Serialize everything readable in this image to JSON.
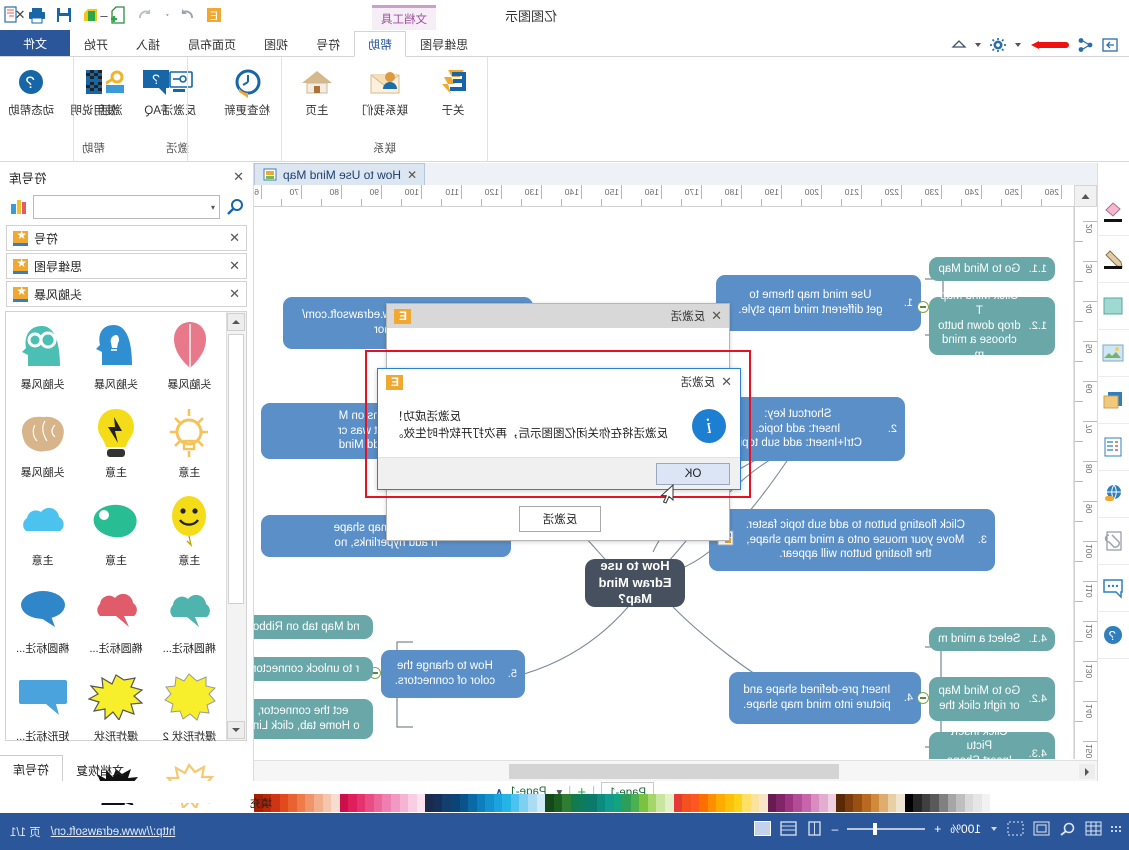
{
  "window": {
    "title": "亿图图示",
    "controls": {
      "close": "✕",
      "maximize": "□",
      "minimize": "–"
    }
  },
  "quick_access": {
    "icons": [
      "customize-icon",
      "dropdown-caret-icon",
      "print-preview-icon",
      "print-icon",
      "save-icon",
      "new-color-icon",
      "new-doc-icon",
      "undo-icon",
      "undo-caret-icon",
      "redo-icon",
      "edraw-logo-icon"
    ]
  },
  "ribbon": {
    "context_tab": "文档工具",
    "tabs": [
      {
        "label": "文件",
        "state": "file"
      },
      {
        "label": "开始",
        "state": "normal"
      },
      {
        "label": "插入",
        "state": "normal"
      },
      {
        "label": "页面布局",
        "state": "normal"
      },
      {
        "label": "视图",
        "state": "normal"
      },
      {
        "label": "符号",
        "state": "normal"
      },
      {
        "label": "帮助",
        "state": "active"
      },
      {
        "label": "思维导图",
        "state": "normal"
      }
    ],
    "groups": [
      {
        "name": "联系",
        "items": [
          {
            "label": "关于",
            "icon": "edraw-about-icon"
          },
          {
            "label": "联系我们",
            "icon": "mail-contact-icon"
          },
          {
            "label": "主页",
            "icon": "home-icon"
          }
        ]
      },
      {
        "name": "激活",
        "items": [
          {
            "label": "检查更新",
            "icon": "check-update-icon"
          },
          {
            "label": "反激活",
            "icon": "deactivate-icon"
          },
          {
            "label": "激活",
            "icon": "activate-key-icon"
          }
        ]
      },
      {
        "name": "帮助",
        "items": [
          {
            "label": "FAQ",
            "icon": "faq-icon"
          },
          {
            "label": "使用说明",
            "icon": "manual-icon"
          },
          {
            "label": "动态帮助",
            "icon": "dynamic-help-icon"
          }
        ]
      }
    ]
  },
  "secondary_toolbar": {
    "icons": [
      "home-small-icon",
      "caret-down-icon",
      "gear-icon",
      "caret-down-icon",
      "red-marker-icon",
      "share-icon",
      "export-icon"
    ]
  },
  "left_tools": [
    {
      "icon": "fill-bucket-icon"
    },
    {
      "icon": "pencil-line-icon"
    },
    {
      "icon": "shape-square-icon"
    },
    {
      "icon": "picture-icon"
    },
    {
      "icon": "layers-icon"
    },
    {
      "icon": "list-data-icon"
    },
    {
      "icon": "hyperlink-globe-icon"
    },
    {
      "icon": "attachment-doc-icon"
    },
    {
      "icon": "comment-icon"
    },
    {
      "icon": "help-circle-icon"
    }
  ],
  "document_tab": {
    "label": "How to Use Mind Map",
    "close": "✕",
    "icon": "document-icon"
  },
  "rulers": {
    "horizontal_ticks": [
      "260",
      "250",
      "240",
      "230",
      "220",
      "210",
      "200",
      "190",
      "180",
      "170",
      "160",
      "150",
      "140",
      "130",
      "120",
      "110",
      "100",
      "90",
      "80",
      "70",
      "60"
    ],
    "vertical_ticks": [
      "20",
      "30",
      "40",
      "50",
      "60",
      "70",
      "80",
      "90",
      "100",
      "110",
      "120",
      "130",
      "140",
      "150"
    ]
  },
  "mindmap": {
    "center": "How to use\nEdraw Mind Map?",
    "nodes": [
      {
        "id": "n1",
        "num": "1.",
        "text": "Use mind map theme to\nget different mind map style."
      },
      {
        "id": "n1_1",
        "num": "1.1.",
        "text": "Go to Mind Map"
      },
      {
        "id": "n1_2",
        "num": "1.2.",
        "text": "Click Mind Map T\ndrop down butto\nchoose a mind m"
      },
      {
        "id": "n2",
        "num": "2.",
        "text": "Shortcut key:\nInsert: add topic.\nCtrl+Insert: add sub topic"
      },
      {
        "id": "n3",
        "num": "3.",
        "text": "Click floating button to add sub topic faster.\nMove your mouse onto a mind map shape,\nthe floating button will appear."
      },
      {
        "id": "n4",
        "num": "4.",
        "text": "Insert pre-defined shape and\npicture into mind map shape."
      },
      {
        "id": "n4_1",
        "num": "4.1.",
        "text": "Select a mind m"
      },
      {
        "id": "n4_2",
        "num": "4.2.",
        "text": "Go to Mind Map\nor right click the"
      },
      {
        "id": "n4_3",
        "num": "4.3.",
        "text": "Click Insert Pictu\nInsert Shape Fro"
      },
      {
        "id": "n5",
        "num": "5.",
        "text": "How to change the\ncolor of connectors."
      },
      {
        "id": "n5_1",
        "num": "",
        "text": "nd Map tab on Ribbon"
      },
      {
        "id": "n5_2",
        "num": "",
        "text": "r to unlock connectors"
      },
      {
        "id": "n5_3",
        "num": "",
        "text": "ect the connector,\no Home tab, click Line"
      },
      {
        "id": "n6",
        "num": "",
        "text": "lick mind map shape\nn add hyperlinks, no"
      },
      {
        "id": "n7",
        "num": "",
        "text": "ore functions on M\na document was cr\ndraw will add Mind"
      },
      {
        "id": "n8",
        "num": "8.",
        "text": "Please visit http://www.edrawsoft.com/\nto get mor"
      }
    ]
  },
  "dialog_back": {
    "title": "反激活",
    "close": "✕"
  },
  "dialog_front": {
    "title": "反激活",
    "close": "✕",
    "line1": "反激活成功！",
    "line2": "反激活将在你关闭亿图图示后，再次打开软件时生效。",
    "ok_label": "OK",
    "icon": "info-icon"
  },
  "middle_button": {
    "label": "反激活"
  },
  "right_panel": {
    "title": "符号库",
    "close": "✕",
    "search_placeholder": "",
    "search_icon": "search-icon",
    "libraries": [
      {
        "name": "符号",
        "close": "✕"
      },
      {
        "name": "思维导图",
        "close": "✕"
      },
      {
        "name": "头脑风暴",
        "close": "✕"
      }
    ],
    "symbols": [
      {
        "label": "头脑风暴",
        "art": "brain-pink-icon",
        "color": "#e8798b"
      },
      {
        "label": "头脑风暴",
        "art": "head-bulb-icon",
        "color": "#2f8fd0"
      },
      {
        "label": "头脑风暴",
        "art": "head-gears-icon",
        "color": "#4bbfb3"
      },
      {
        "label": "主意",
        "art": "bulb-rays-icon",
        "color": "#f4c35a"
      },
      {
        "label": "主意",
        "art": "bulb-yellow-icon",
        "color": "#f5dc19"
      },
      {
        "label": "头脑风暴",
        "art": "brain-tan-icon",
        "color": "#d7b48a"
      },
      {
        "label": "主意",
        "art": "balloon-smiley-icon",
        "color": "#f5dc19"
      },
      {
        "label": "主意",
        "art": "blob-green-icon",
        "color": "#28bd93"
      },
      {
        "label": "主意",
        "art": "cloud-blue-icon",
        "color": "#4cc3ef"
      },
      {
        "label": "椭圆标注...",
        "art": "cloud-teal-icon",
        "color": "#4fb3ae"
      },
      {
        "label": "椭圆标注...",
        "art": "cloud-red-icon",
        "color": "#e05c6a"
      },
      {
        "label": "椭圆标注...",
        "art": "speech-ellipse-icon",
        "color": "#2f86c8"
      },
      {
        "label": "爆炸形状 2",
        "art": "burst-yellow-icon",
        "color": "#f7ef2b"
      },
      {
        "label": "爆炸形状",
        "art": "starburst-icon",
        "color": "#f7ef2b"
      },
      {
        "label": "矩形标注...",
        "art": "speech-rect-icon",
        "color": "#4aa3dd"
      },
      {
        "label": "文档恢复",
        "art": "sun-soft-icon",
        "color": "#f6c871"
      },
      {
        "label": "符号库",
        "art": "burst-black-icon",
        "color": "#111111"
      }
    ],
    "tabs": [
      {
        "label": "文档恢复",
        "active": false
      },
      {
        "label": "符号库",
        "active": true
      }
    ]
  },
  "page_tabs": {
    "tabs": [
      {
        "label": "Page-1",
        "selected": true
      }
    ],
    "nav_label": "Page-1",
    "add": "+",
    "caret": "▾",
    "prev": "∧"
  },
  "palette": {
    "label": "填充",
    "colors": [
      "#ffffff",
      "#f2f2f2",
      "#e6e6e6",
      "#d9d9d9",
      "#bfbfbf",
      "#a6a6a6",
      "#808080",
      "#595959",
      "#404040",
      "#262626",
      "#000000",
      "#efe4d0",
      "#e8cfa6",
      "#dfae6e",
      "#cf8a3c",
      "#b96a22",
      "#9a4f13",
      "#7c3c0c",
      "#5a2a07",
      "#f0cfe0",
      "#e2aed0",
      "#d98cc0",
      "#c765aa",
      "#b24c96",
      "#9c3480",
      "#7f2568",
      "#681a53",
      "#f6e5c8",
      "#fae3a0",
      "#ffe066",
      "#ffd21a",
      "#ffc107",
      "#ffab00",
      "#ff8f00",
      "#ff6f00",
      "#ff5722",
      "#f4511e",
      "#e53935",
      "#e2f0c8",
      "#c8e6a0",
      "#a5d66a",
      "#7cc242",
      "#4caf50",
      "#2e9e5b",
      "#14a37f",
      "#0f9b8e",
      "#0b8c7e",
      "#0a7a6a",
      "#0e7a5f",
      "#117a4f",
      "#2f7d32",
      "#1b5e20",
      "#15491a",
      "#cfe9f7",
      "#aadcf4",
      "#7fd0f0",
      "#4cc3ef",
      "#24b4e8",
      "#1aa3de",
      "#1292cf",
      "#0c7fbd",
      "#0a6aa5",
      "#09558b",
      "#0b4477",
      "#123f6e",
      "#16305a",
      "#1c2a4e",
      "#fbe3ef",
      "#f9cde2",
      "#f6b4d3",
      "#f299c3",
      "#ef7fae",
      "#ec6699",
      "#ea4d85",
      "#e53370",
      "#df1f5c",
      "#cc0f4a",
      "#f6ddd0",
      "#f5c6ae",
      "#f3ae8c",
      "#f0956a",
      "#ed7c49",
      "#e96330",
      "#e04a1e",
      "#d03513",
      "#bb2709",
      "#a41f05"
    ]
  },
  "status_bar": {
    "zoom": "100%",
    "icons": [
      "grid-icon",
      "zoom-fit-icon",
      "page-grid-icon",
      "select-box-icon",
      "caret-down-icon"
    ],
    "zoom_out": "–",
    "zoom_in": "+",
    "view_icons": [
      "single-page-icon",
      "two-page-icon",
      "fit-page-icon"
    ],
    "page_count": "页 1/1",
    "url": "http://www.edrawsoft.cn/"
  }
}
